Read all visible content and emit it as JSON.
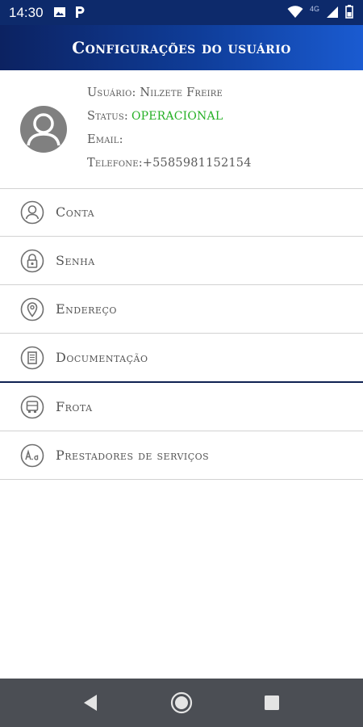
{
  "status_bar": {
    "time": "14:30",
    "left_icons": [
      "image-icon",
      "parking-p-icon"
    ],
    "right_icons": [
      "wifi-icon",
      "signal-icon",
      "battery-icon"
    ],
    "network": "4G"
  },
  "header": {
    "title": "Configurações do usuário"
  },
  "profile": {
    "user_label": "Usuário: Nilzete Freire",
    "status_label": "Status:",
    "status_value": "OPERACIONAL",
    "status_color": "#25b025",
    "email_label": "Email:",
    "phone_label": "Telefone:+5585981152154"
  },
  "menu": [
    {
      "label": "Conta",
      "icon": "person-icon"
    },
    {
      "label": "Senha",
      "icon": "lock-icon"
    },
    {
      "label": "Endereço",
      "icon": "location-pin-icon"
    },
    {
      "label": "Documentação",
      "icon": "document-icon"
    },
    {
      "label": "Frota",
      "icon": "truck-icon"
    },
    {
      "label": "Prestadores de serviços",
      "icon": "aa-icon"
    }
  ],
  "colors": {
    "primary_dark": "#0c2261",
    "primary_light": "#1a5bd1",
    "nav_bar": "#4b4e54"
  },
  "nav_bar": {
    "buttons": [
      "back-icon",
      "home-icon",
      "recents-icon"
    ]
  }
}
